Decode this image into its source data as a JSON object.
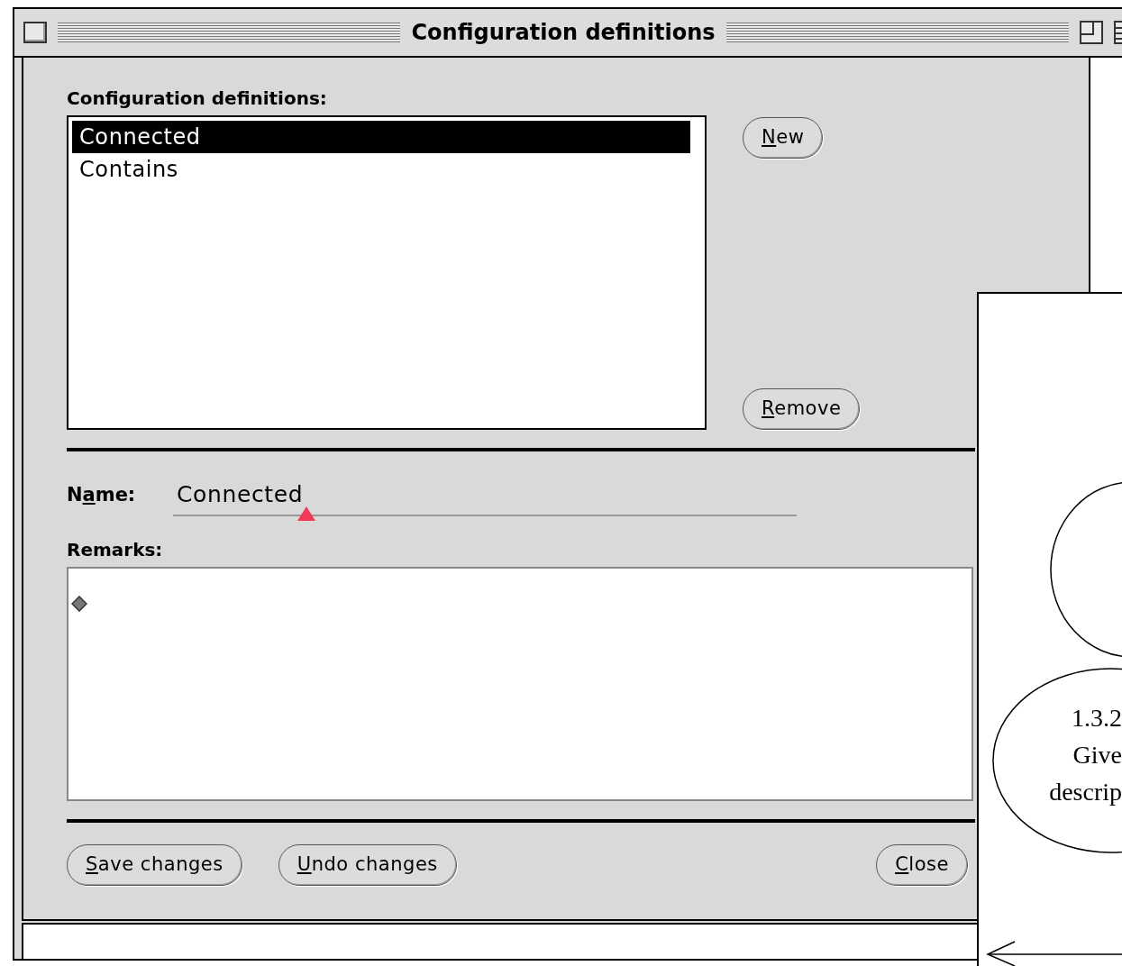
{
  "window": {
    "title": "Configuration definitions"
  },
  "definitions": {
    "label": "Configuration definitions:",
    "items": [
      {
        "text": "Connected",
        "selected": true
      },
      {
        "text": "Contains",
        "selected": false
      }
    ]
  },
  "side_buttons": [
    {
      "key": "N",
      "tail": "ew"
    },
    {
      "key": "R",
      "tail": "emove"
    }
  ],
  "name_field": {
    "label": {
      "lead": "N",
      "key": "a",
      "tail": "me:"
    },
    "value": "Connected"
  },
  "remarks": {
    "label": "Remarks:"
  },
  "buttons": [
    {
      "key": "S",
      "tail": "ave changes"
    },
    {
      "key": "U",
      "tail": "ndo changes"
    },
    {
      "key": "C",
      "tail": "lose"
    }
  ],
  "diagram": {
    "nodes": [
      {
        "kind": "ellipse"
      },
      {
        "kind": "ellipse",
        "lines": [
          "1.3.2",
          "Give",
          "descrip"
        ]
      }
    ]
  }
}
